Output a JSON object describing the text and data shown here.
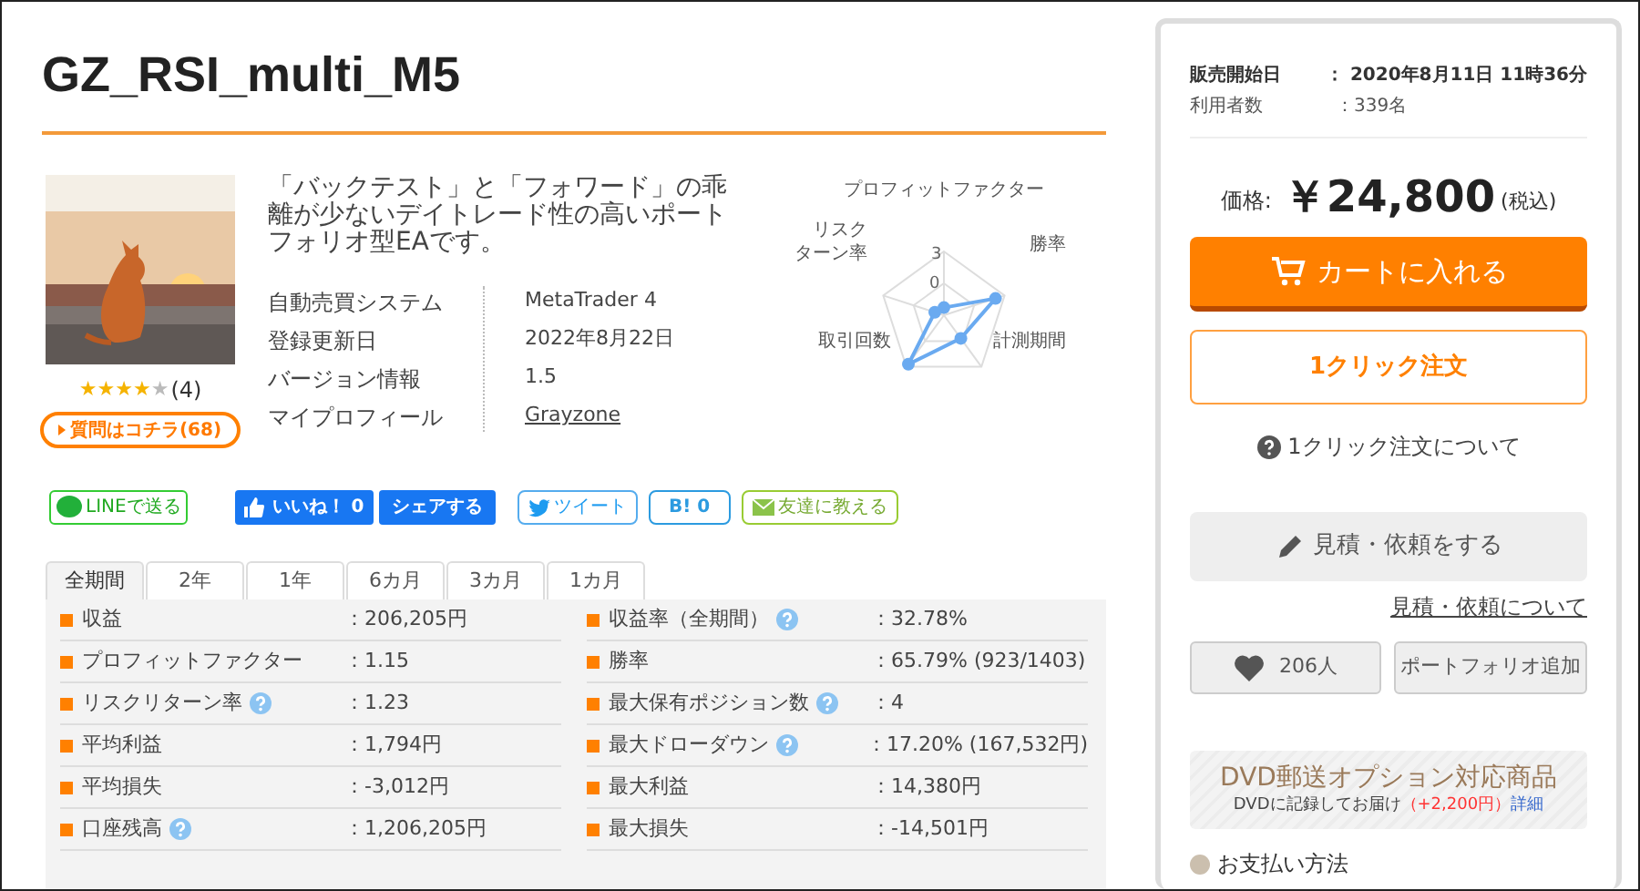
{
  "title": "GZ_RSI_multi_M5",
  "product": {
    "stars": 4,
    "review_count": "(4)",
    "question_button": "質問はコチラ(68)"
  },
  "description": "「バックテスト」と「フォワード」の乖離が少ないデイトレード性の高いポートフォリオ型EAです。",
  "info": [
    {
      "label": "自動売買システム",
      "value": "MetaTrader 4",
      "link": false
    },
    {
      "label": "登録更新日",
      "value": "2022年8月22日",
      "link": false
    },
    {
      "label": "バージョン情報",
      "value": "1.5",
      "link": false
    },
    {
      "label": "マイプロフィール",
      "value": "Grayzone",
      "link": true
    }
  ],
  "radar": {
    "axes": [
      {
        "lines": [
          "プロフィットファクター"
        ]
      },
      {
        "lines": [
          "リスク",
          "ターン率"
        ]
      },
      {
        "lines": [
          "勝率"
        ]
      },
      {
        "lines": [
          "取引回数"
        ]
      },
      {
        "lines": [
          "計測期間"
        ]
      }
    ],
    "tick_max": "3",
    "tick_min": "0"
  },
  "share": [
    {
      "kind": "line",
      "label": "LINEで送る"
    },
    {
      "kind": "like",
      "label": "いいね！ 0"
    },
    {
      "kind": "fbshare",
      "label": "シェアする"
    },
    {
      "kind": "tweet",
      "label": "ツイート"
    },
    {
      "kind": "hatena",
      "label": "B! 0"
    },
    {
      "kind": "mail",
      "label": "友達に教える"
    }
  ],
  "tabs": [
    {
      "label": "全期間",
      "selected": true
    },
    {
      "label": "2年",
      "selected": false
    },
    {
      "label": "1年",
      "selected": false
    },
    {
      "label": "6カ月",
      "selected": false
    },
    {
      "label": "3カ月",
      "selected": false
    },
    {
      "label": "1カ月",
      "selected": false
    }
  ],
  "stats_left": [
    {
      "label": "収益",
      "help": false,
      "value": "：206,205円"
    },
    {
      "label": "プロフィットファクター",
      "help": false,
      "value": "：1.15"
    },
    {
      "label": "リスクリターン率",
      "help": true,
      "value": "：1.23"
    },
    {
      "label": "平均利益",
      "help": false,
      "value": "：1,794円"
    },
    {
      "label": "平均損失",
      "help": false,
      "value": "：-3,012円"
    },
    {
      "label": "口座残高",
      "help": true,
      "value": "：1,206,205円"
    }
  ],
  "stats_right": [
    {
      "label": "収益率（全期間）",
      "help": true,
      "value": "：32.78%"
    },
    {
      "label": "勝率",
      "help": false,
      "value": "：65.79% (923/1403)"
    },
    {
      "label": "最大保有ポジション数",
      "help": true,
      "value": "：4"
    },
    {
      "label": "最大ドローダウン",
      "help": true,
      "value": "：17.20% (167,532円)"
    },
    {
      "label": "最大利益",
      "help": false,
      "value": "：14,380円"
    },
    {
      "label": "最大損失",
      "help": false,
      "value": "：-14,501円"
    }
  ],
  "sidebar": {
    "meta": [
      {
        "label": "販売開始日",
        "value": "： 2020年8月11日 11時36分",
        "bold": true
      },
      {
        "label": "利用者数",
        "value": "：339名",
        "bold": false
      }
    ],
    "price_label": "価格:",
    "price": "￥24,800",
    "tax": "(税込)",
    "cart_button": "カートに入れる",
    "one_click_button": "1クリック注文",
    "one_click_help": "1クリック注文について",
    "estimate_button": "見積・依頼をする",
    "estimate_link": "見積・依頼について",
    "favorite_count": "206人",
    "portfolio_button": "ポートフォリオ追加",
    "dvd": {
      "title": "DVD郵送オプション対応商品",
      "text": "DVDに記録してお届け",
      "extra": "（+2,200円）",
      "link": "詳細"
    },
    "payment": "お支払い方法"
  }
}
